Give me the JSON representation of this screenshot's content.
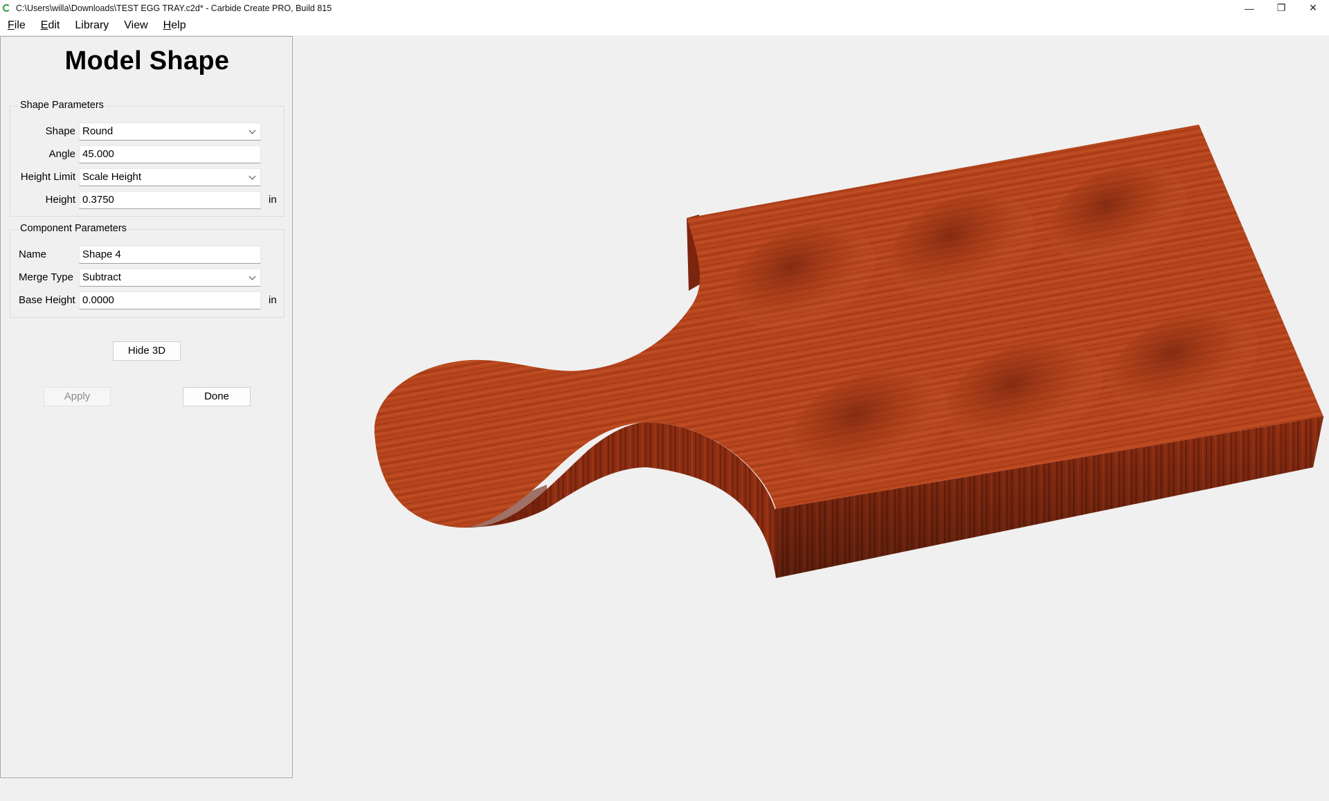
{
  "window": {
    "title": "C:\\Users\\willa\\Downloads\\TEST EGG TRAY.c2d* - Carbide Create PRO, Build 815",
    "controls": [
      "—",
      "❐",
      "✕"
    ]
  },
  "menu": [
    {
      "mnemonic": "F",
      "rest": "ile"
    },
    {
      "mnemonic": "E",
      "rest": "dit"
    },
    {
      "mnemonic": "",
      "rest": "Library"
    },
    {
      "mnemonic": "",
      "rest": "View"
    },
    {
      "mnemonic": "H",
      "rest": "elp"
    }
  ],
  "panel": {
    "title": "Model Shape",
    "shape_group": {
      "label": "Shape Parameters",
      "shape_label": "Shape",
      "shape_value": "Round",
      "angle_label": "Angle",
      "angle_value": "45.000",
      "height_limit_label": "Height Limit",
      "height_limit_value": "Scale Height",
      "height_label": "Height",
      "height_value": "0.3750",
      "height_unit": "in"
    },
    "component_group": {
      "label": "Component Parameters",
      "name_label": "Name",
      "name_value": "Shape 4",
      "merge_label": "Merge Type",
      "merge_value": "Subtract",
      "base_label": "Base Height",
      "base_value": "0.0000",
      "base_unit": "in"
    },
    "hide3d_label": "Hide 3D",
    "apply_label": "Apply",
    "done_label": "Done"
  },
  "colors": {
    "wood_top": "#b5441d",
    "wood_side": "#6e1f0c",
    "wood_front": "#8a2c12",
    "background": "#f0f0f0"
  }
}
